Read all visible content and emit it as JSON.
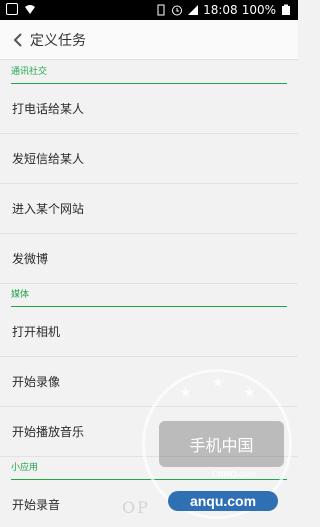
{
  "status_bar": {
    "time": "18:08",
    "battery": "100%"
  },
  "header": {
    "title": "定义任务"
  },
  "sections": [
    {
      "title": "通讯社交",
      "items": [
        "打电话给某人",
        "发短信给某人",
        "进入某个网站",
        "发微博"
      ]
    },
    {
      "title": "媒体",
      "items": [
        "打开相机",
        "开始录像",
        "开始播放音乐"
      ]
    },
    {
      "title": "小应用",
      "items": [
        "开始录音"
      ]
    }
  ],
  "watermark": {
    "brand": "手机中国",
    "brand_en": "CNMO.com",
    "url": "anqu.com",
    "oppo": "OP"
  }
}
